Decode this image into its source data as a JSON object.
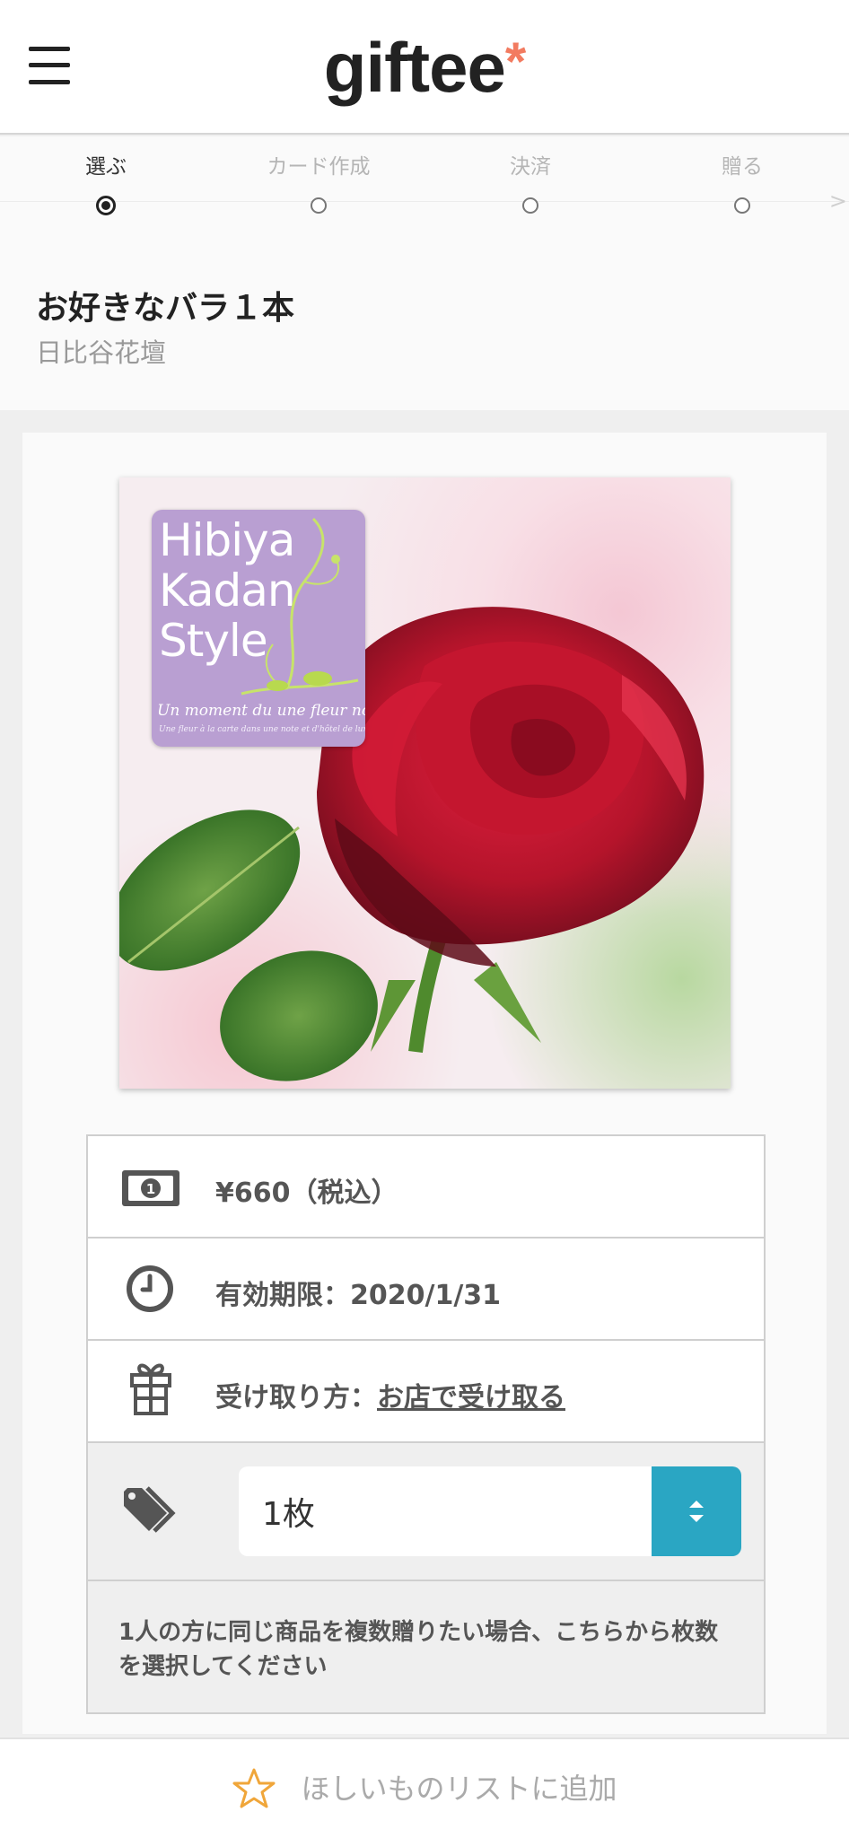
{
  "app": {
    "logo": "giftee",
    "logo_mark": "*",
    "menu_icon": "hamburger-menu-icon"
  },
  "steps": [
    {
      "label": "選ぶ",
      "active": true
    },
    {
      "label": "カード作成",
      "active": false
    },
    {
      "label": "決済",
      "active": false
    },
    {
      "label": "贈る",
      "active": false
    }
  ],
  "steps_more": ">",
  "product": {
    "title": "お好きなバラ１本",
    "shop": "日比谷花壇",
    "brand_lines": [
      "Hibiya",
      "Kadan",
      "Style"
    ],
    "brand_tagline": "Un moment du une fleur noble",
    "brand_subtagline": "Une fleur à la carte dans une note et d'hôtel de luxe."
  },
  "info": {
    "price": "¥660（税込）",
    "expiry_label": "有効期限：",
    "expiry_value": "2020/1/31",
    "receive_label": "受け取り方：",
    "receive_link": "お店で受け取る",
    "quantity_value": "1枚",
    "note": "1人の方に同じ商品を複数贈りたい場合、こちらから枚数を選択してください"
  },
  "icons": {
    "price": "money-bill-icon",
    "expiry": "clock-icon",
    "receive": "gift-icon",
    "quantity": "tags-icon",
    "select": "select-arrows-icon",
    "wishlist": "star-icon"
  },
  "colors": {
    "accent": "#2aa6c3",
    "logo_mark": "#f27b60",
    "star": "#f0a63a"
  },
  "wishlist": {
    "label": "ほしいものリストに追加"
  }
}
